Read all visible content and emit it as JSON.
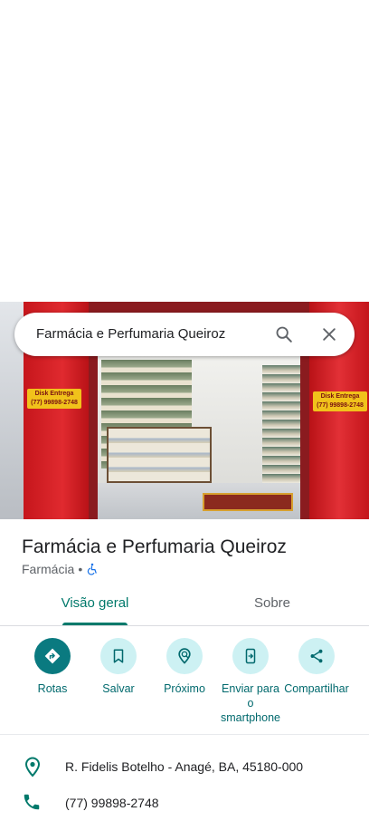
{
  "search": {
    "query": "Farmácia e Perfumaria Queiroz"
  },
  "photo": {
    "sign_left_line1": "Disk Entrega",
    "sign_left_line2": "(77) 99898-2748",
    "sign_right_line1": "Disk Entrega",
    "sign_right_line2": "(77) 99898-2748"
  },
  "place": {
    "name": "Farmácia e Perfumaria Queiroz",
    "category": "Farmácia",
    "separator": "•",
    "accessibility_icon": "wheelchair-icon"
  },
  "tabs": [
    {
      "label": "Visão geral",
      "active": true
    },
    {
      "label": "Sobre",
      "active": false
    }
  ],
  "actions": [
    {
      "label": "Rotas",
      "icon": "directions-icon"
    },
    {
      "label": "Salvar",
      "icon": "bookmark-icon"
    },
    {
      "label": "Próximo",
      "icon": "nearby-icon"
    },
    {
      "label": "Enviar para o smartphone",
      "icon": "send-to-phone-icon"
    },
    {
      "label": "Compartilhar",
      "icon": "share-icon"
    }
  ],
  "info": {
    "address": "R. Fidelis Botelho - Anagé, BA, 45180-000",
    "phone": "(77) 99898-2748"
  },
  "colors": {
    "accent": "#00796b",
    "action_primary": "#0a7a80",
    "action_bg": "#cdf1f3",
    "text_primary": "#202124",
    "text_secondary": "#5f6368"
  }
}
